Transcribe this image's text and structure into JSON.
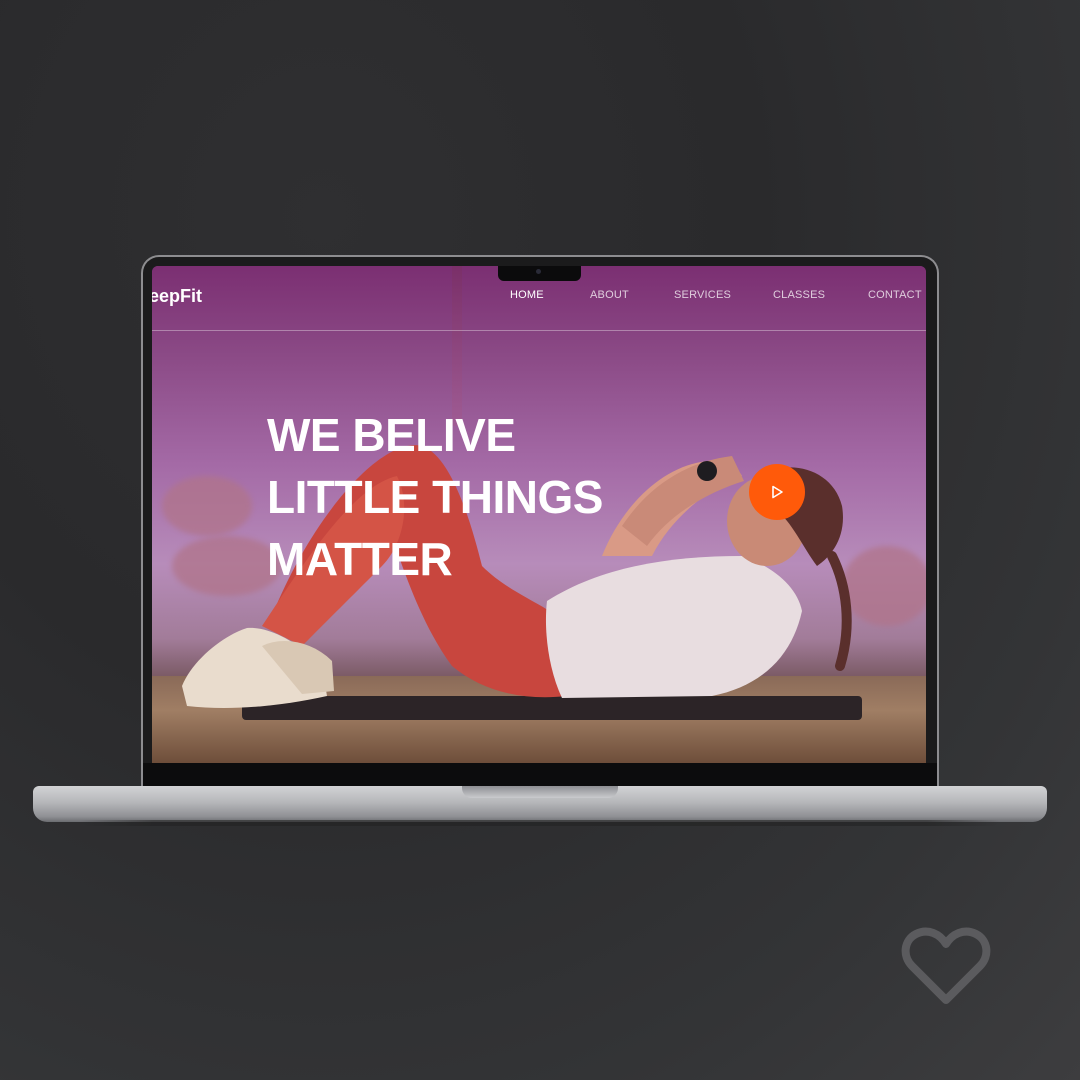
{
  "site": {
    "logo_text": "eepFit"
  },
  "nav": {
    "items": [
      {
        "label": "HOME",
        "active": true
      },
      {
        "label": "ABOUT",
        "active": false
      },
      {
        "label": "SERVICES",
        "active": false
      },
      {
        "label": "CLASSES",
        "active": false
      },
      {
        "label": "CONTACT",
        "active": false
      }
    ]
  },
  "hero": {
    "headline_lines": [
      "WE BELIVE",
      "LITTLE THINGS",
      "MATTER"
    ],
    "play_icon": "play-icon",
    "play_color": "#ff5a0a"
  },
  "overlay": {
    "heart_icon": "heart-icon"
  }
}
